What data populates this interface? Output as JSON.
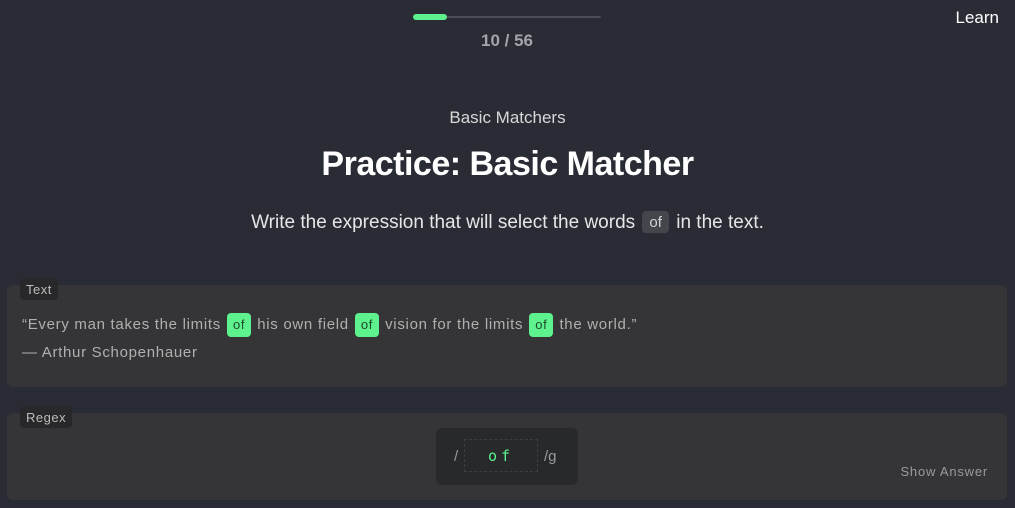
{
  "progress": {
    "current": 10,
    "total": 56,
    "label": "10 / 56",
    "accent_color": "#5df28d"
  },
  "nav": {
    "learn_label": "Learn"
  },
  "lesson": {
    "subtitle": "Basic Matchers",
    "title": "Practice: Basic Matcher",
    "instruction_before": "Write the expression that will select the words",
    "instruction_code": "of",
    "instruction_after": "in the text."
  },
  "text_panel": {
    "tag": "Text",
    "segments": [
      "“Every man takes the limits",
      "of",
      "his own field",
      "of",
      "vision for the limits",
      "of",
      "the world.”"
    ],
    "attribution": "— Arthur Schopenhauer"
  },
  "regex_panel": {
    "tag": "Regex",
    "open_delimiter": "/",
    "input_value": "of",
    "flags": "/g",
    "show_answer_label": "Show Answer"
  }
}
